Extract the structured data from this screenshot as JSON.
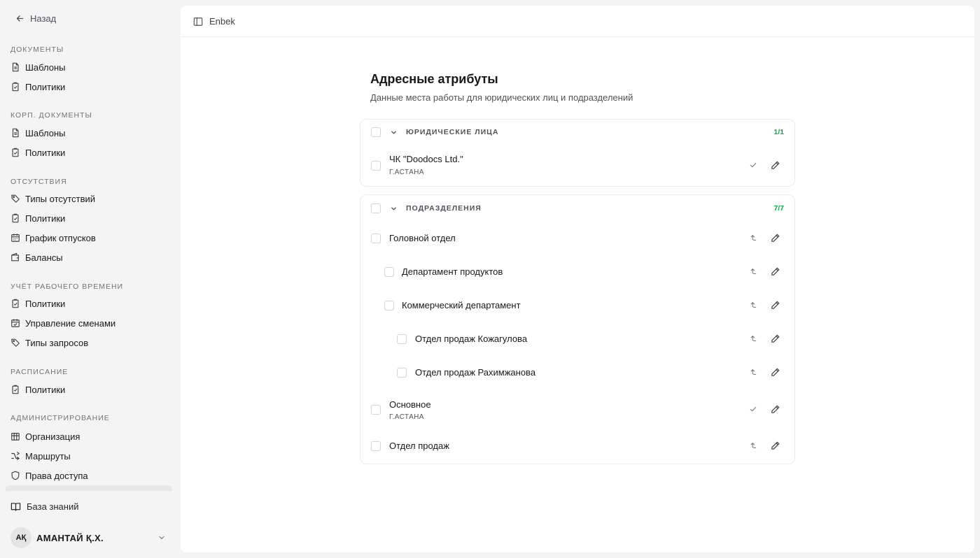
{
  "sidebar": {
    "back_label": "Назад",
    "sections": [
      {
        "title": "Документы",
        "items": [
          {
            "label": "Шаблоны",
            "icon": "file-text-icon"
          },
          {
            "label": "Политики",
            "icon": "clipboard-check-icon"
          }
        ]
      },
      {
        "title": "Корп. документы",
        "items": [
          {
            "label": "Шаблоны",
            "icon": "file-text-icon"
          },
          {
            "label": "Политики",
            "icon": "clipboard-check-icon"
          }
        ]
      },
      {
        "title": "Отсутствия",
        "items": [
          {
            "label": "Типы отсутствий",
            "icon": "tag-icon"
          },
          {
            "label": "Политики",
            "icon": "clipboard-check-icon"
          },
          {
            "label": "График отпусков",
            "icon": "calendar-icon"
          },
          {
            "label": "Балансы",
            "icon": "wallet-icon"
          }
        ]
      },
      {
        "title": "Учёт рабочего времени",
        "items": [
          {
            "label": "Политики",
            "icon": "clipboard-check-icon"
          },
          {
            "label": "Управление сменами",
            "icon": "calendar-check-icon"
          },
          {
            "label": "Типы запросов",
            "icon": "tag-icon"
          }
        ]
      },
      {
        "title": "Расписание",
        "items": [
          {
            "label": "Политики",
            "icon": "clipboard-check-icon"
          }
        ]
      },
      {
        "title": "Администрирование",
        "items": [
          {
            "label": "Организация",
            "icon": "building-icon"
          },
          {
            "label": "Маршруты",
            "icon": "route-icon"
          },
          {
            "label": "Права доступа",
            "icon": "shield-icon"
          }
        ]
      }
    ],
    "knowledge_base": "База знаний",
    "user": {
      "initials": "АҚ",
      "name": "АМАНТАЙ Қ.Х."
    }
  },
  "topbar": {
    "breadcrumb": "Enbek"
  },
  "page": {
    "title": "Адресные атрибуты",
    "subtitle": "Данные места работы для юридических лиц и подразделений"
  },
  "legal_entities": {
    "label": "Юридические лица",
    "count": "1/1",
    "rows": [
      {
        "name": "ЧК \"Doodocs Ltd.\"",
        "sub": "Г.АСТАНА",
        "action": "check-icon"
      }
    ]
  },
  "departments": {
    "label": "Подразделения",
    "count": "7/7",
    "rows": [
      {
        "name": "Головной отдел",
        "level": 0,
        "action": "corner-up-icon"
      },
      {
        "name": "Департамент продуктов",
        "level": 1,
        "action": "corner-up-icon"
      },
      {
        "name": "Коммерческий департамент",
        "level": 1,
        "action": "corner-up-icon"
      },
      {
        "name": "Отдел продаж Кожагулова",
        "level": 2,
        "action": "corner-up-icon"
      },
      {
        "name": "Отдел продаж Рахимжанова",
        "level": 2,
        "action": "corner-up-icon"
      },
      {
        "name": "Основное",
        "sub": "Г.АСТАНА",
        "level": 0,
        "action": "check-icon"
      },
      {
        "name": "Отдел продаж",
        "level": 0,
        "action": "corner-up-icon"
      }
    ]
  }
}
